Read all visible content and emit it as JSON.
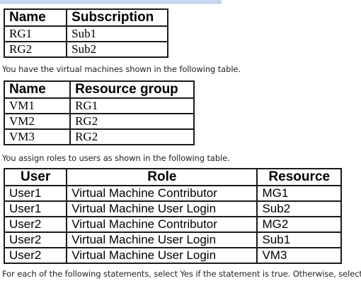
{
  "table_subscriptions": {
    "headers": [
      "Name",
      "Subscription"
    ],
    "rows": [
      [
        "RG1",
        "Sub1"
      ],
      [
        "RG2",
        "Sub2"
      ]
    ]
  },
  "text_vms_intro": "You have the virtual machines shown in the following table.",
  "table_vms": {
    "headers": [
      "Name",
      "Resource group"
    ],
    "rows": [
      [
        "VM1",
        "RG1"
      ],
      [
        "VM2",
        "RG2"
      ],
      [
        "VM3",
        "RG2"
      ]
    ]
  },
  "text_roles_intro": "You assign roles to users as shown in the following table.",
  "table_roles": {
    "headers": [
      "User",
      "Role",
      "Resource"
    ],
    "rows": [
      [
        "User1",
        "Virtual Machine Contributor",
        "MG1"
      ],
      [
        "User1",
        "Virtual Machine User Login",
        "Sub2"
      ],
      [
        "User2",
        "Virtual Machine Contributor",
        "MG2"
      ],
      [
        "User2",
        "Virtual Machine User Login",
        "Sub1"
      ],
      [
        "User2",
        "Virtual Machine User Login",
        "VM3"
      ]
    ]
  },
  "text_instructions": "For each of the following statements, select Yes if the statement is true. Otherwise, select No."
}
